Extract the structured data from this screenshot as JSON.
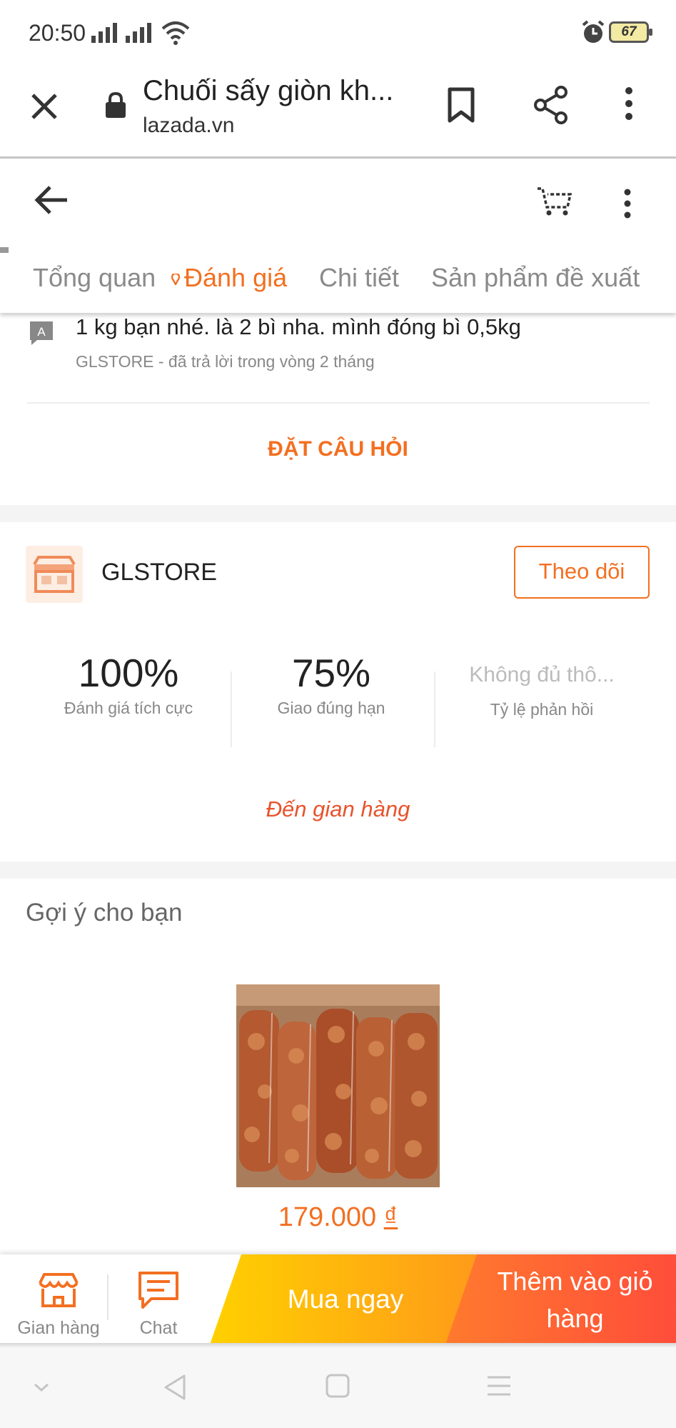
{
  "status_bar": {
    "time": "20:50",
    "battery": "67"
  },
  "browser": {
    "title": "Chuối sấy giòn kh...",
    "url": "lazada.vn"
  },
  "tabs": [
    {
      "label": "Tổng quan"
    },
    {
      "label": "Đánh giá",
      "active": true
    },
    {
      "label": "Chi tiết"
    },
    {
      "label": "Sản phẩm đề xuất"
    }
  ],
  "qa": {
    "answer_badge": "A",
    "answer": "1 kg bạn nhé. là 2 bì nha. mình đóng bì 0,5kg",
    "meta": "GLSTORE - đã trả lời trong vòng 2 tháng",
    "ask_button": "ĐẶT CÂU HỎI"
  },
  "store": {
    "name": "GLSTORE",
    "follow_button": "Theo dõi",
    "stats": [
      {
        "value": "100%",
        "label": "Đánh giá tích cực"
      },
      {
        "value": "75%",
        "label": "Giao đúng hạn"
      },
      {
        "value": "Không đủ thô...",
        "label": "Tỷ lệ phản hồi"
      }
    ],
    "visit_link": "Đến gian hàng"
  },
  "recommendations": {
    "title": "Gợi ý cho bạn",
    "product": {
      "price": "179.000",
      "currency": "₫"
    }
  },
  "action_bar": {
    "store_label": "Gian hàng",
    "chat_label": "Chat",
    "buy_now": "Mua ngay",
    "add_to_cart": "Thêm vào giỏ hàng"
  },
  "colors": {
    "accent": "#f36f21",
    "link": "#e8532b",
    "buy_gradient": [
      "#ffd000",
      "#ff9a1a"
    ],
    "cart_gradient": [
      "#ff7a2e",
      "#ff4d3a"
    ]
  }
}
